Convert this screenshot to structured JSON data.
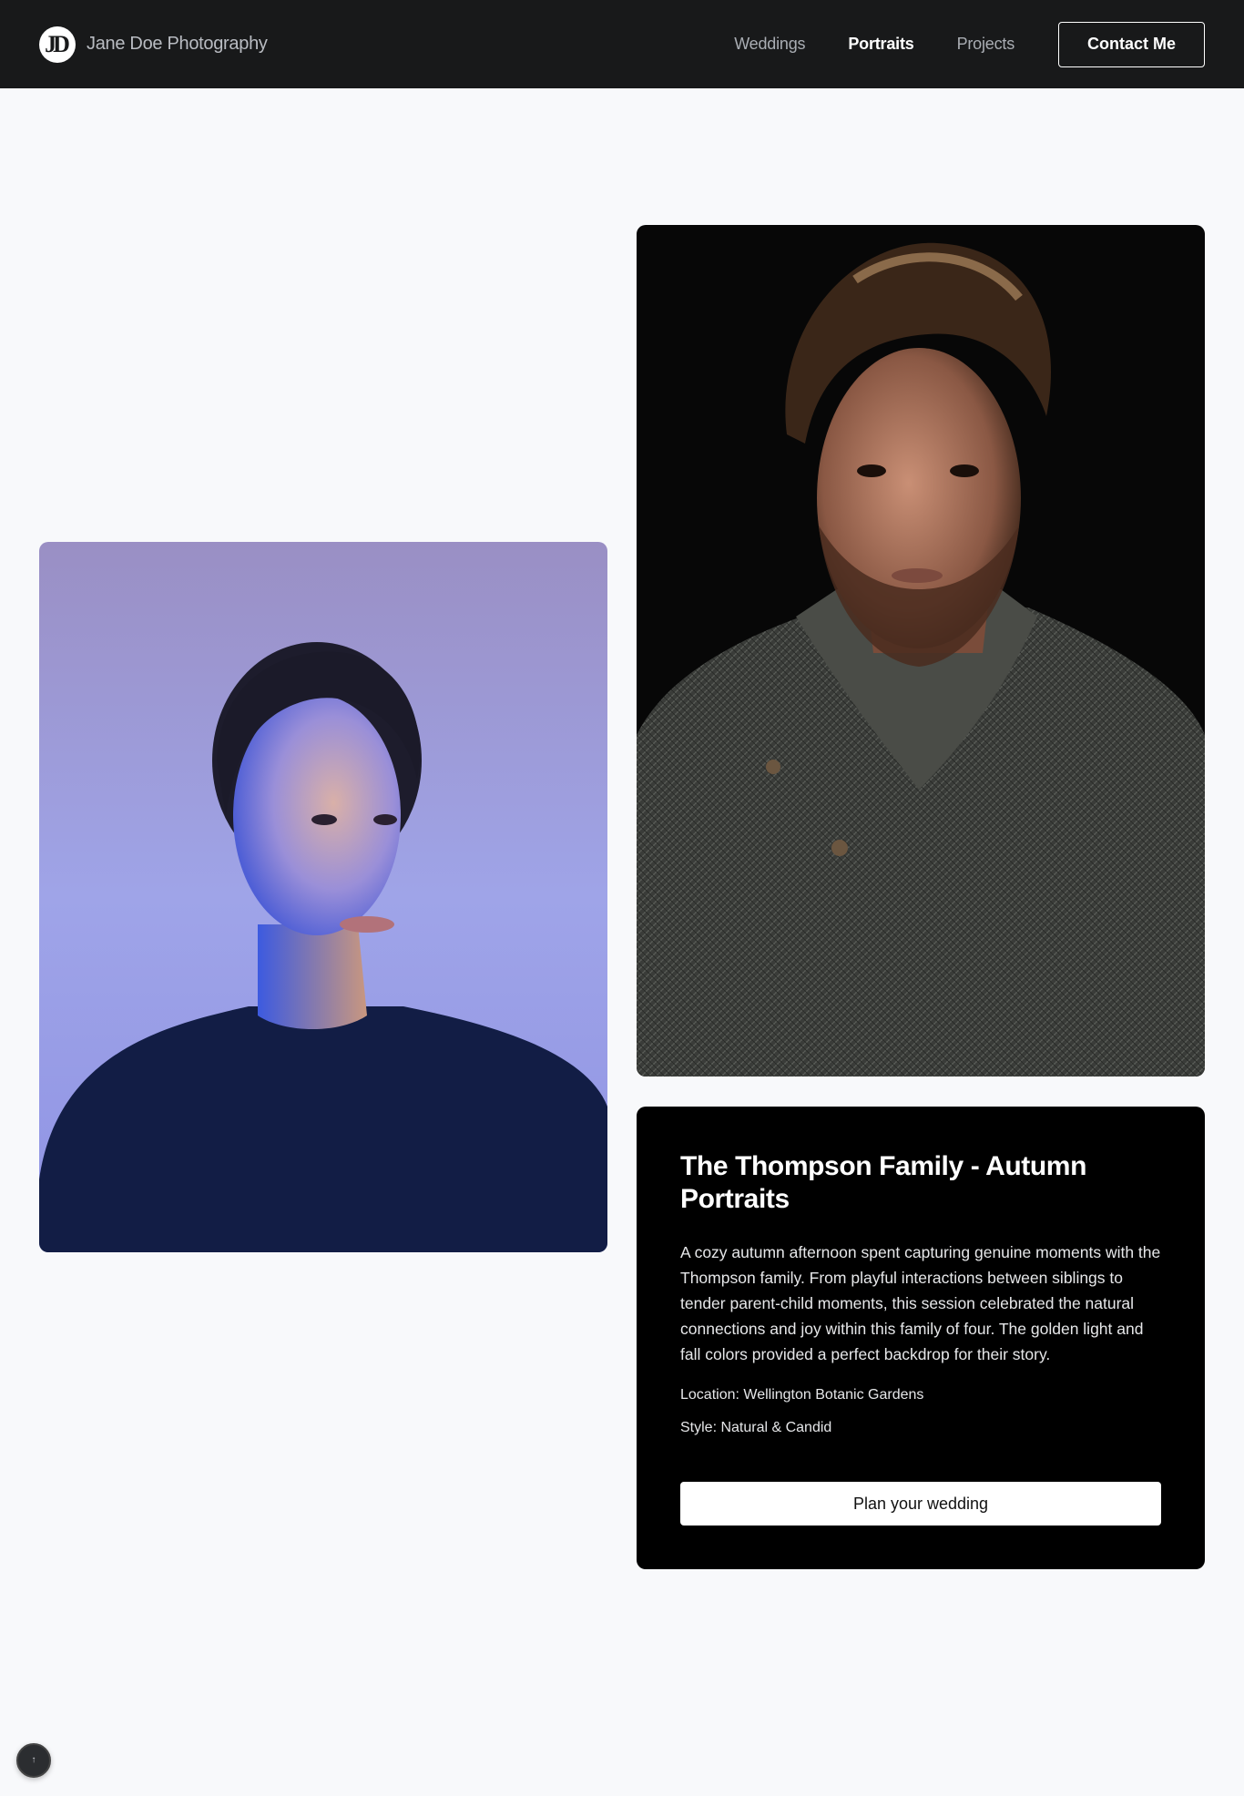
{
  "brand": {
    "logo_text": "JD",
    "name": "Jane Doe Photography"
  },
  "nav": {
    "items": [
      {
        "label": "Weddings",
        "active": false
      },
      {
        "label": "Portraits",
        "active": true
      },
      {
        "label": "Projects",
        "active": false
      }
    ],
    "contact_label": "Contact Me"
  },
  "photos": {
    "woman_icon": "portrait-photo-woman",
    "man_icon": "portrait-photo-man"
  },
  "card": {
    "title": "The Thompson Family - Autumn Portraits",
    "description": "A cozy autumn afternoon spent capturing genuine moments with the Thompson family. From playful interactions between siblings to tender parent-child moments, this session celebrated the natural connections and joy within this family of four. The golden light and fall colors provided a perfect backdrop for their story.",
    "location": "Location: Wellington Botanic Gardens",
    "style": "Style: Natural & Candid",
    "cta_label": "Plan your wedding"
  },
  "fab": {
    "icon": "arrow-up-icon",
    "glyph": "↑"
  },
  "colors": {
    "nav_bg": "#18191a",
    "page_bg": "#f8f9fb",
    "card_bg": "#000000",
    "accent": "#ffffff"
  }
}
